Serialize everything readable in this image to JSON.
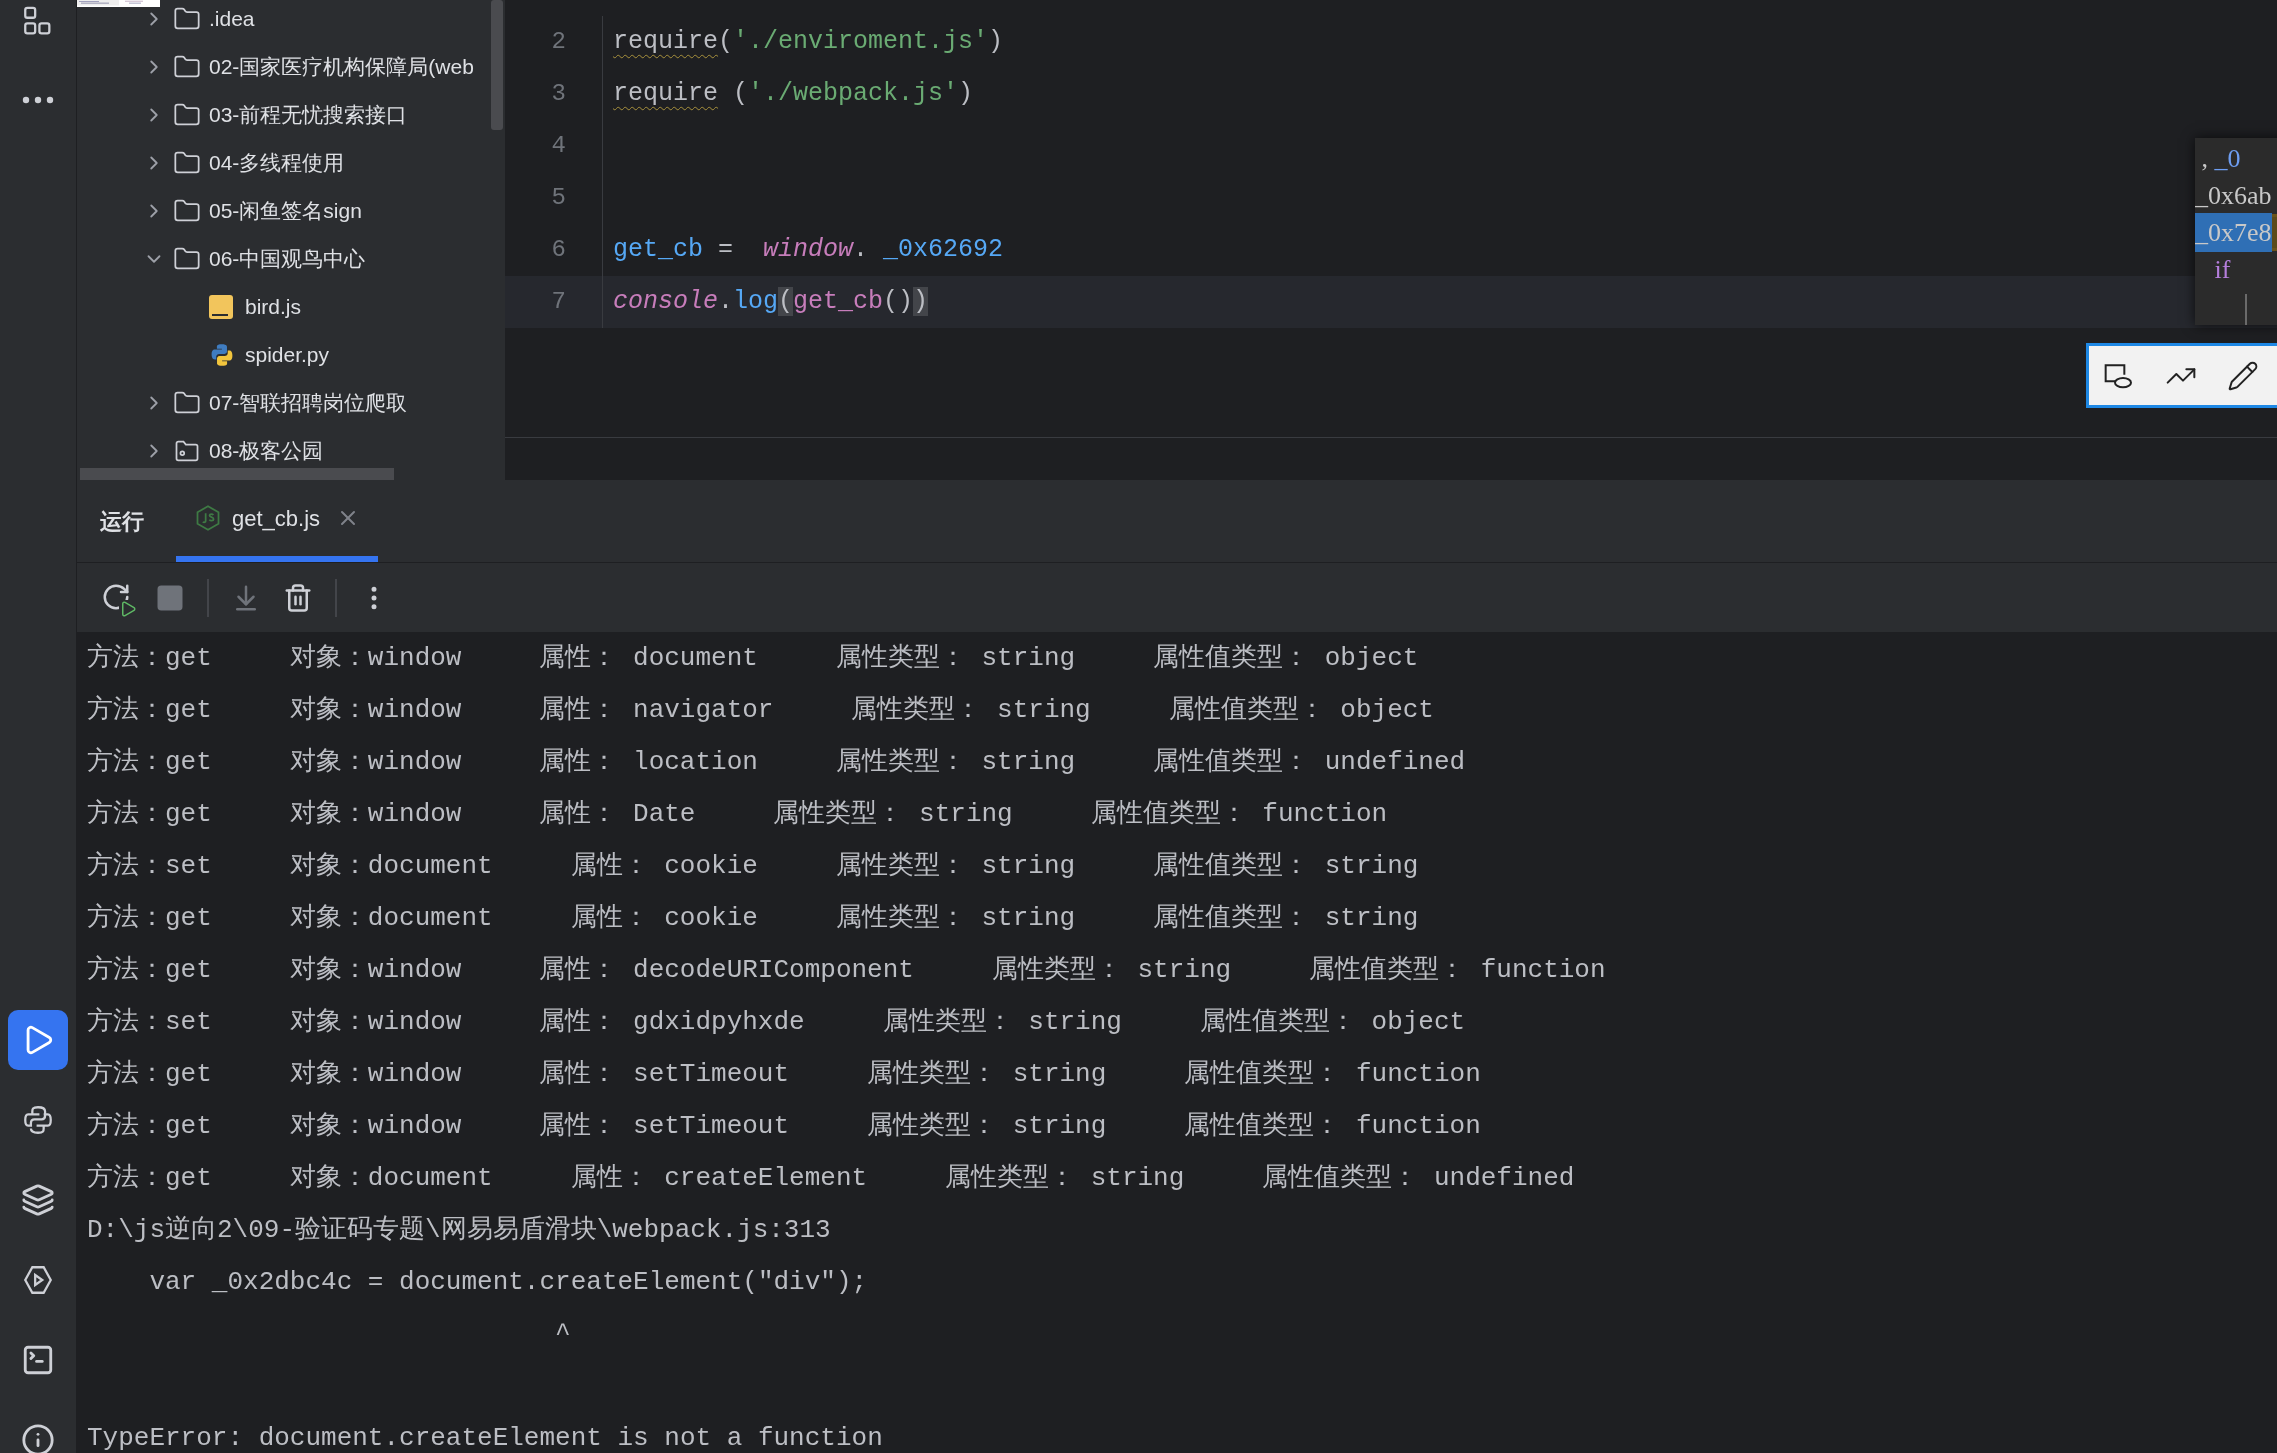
{
  "activity_bar": {
    "top": [
      {
        "kind": "grid",
        "selected": false
      },
      {
        "kind": "more",
        "selected": false
      }
    ],
    "bottom": [
      {
        "kind": "run",
        "selected": true
      },
      {
        "kind": "python",
        "selected": false
      },
      {
        "kind": "layers",
        "selected": false
      },
      {
        "kind": "services",
        "selected": false
      },
      {
        "kind": "terminal",
        "selected": false
      },
      {
        "kind": "problems",
        "selected": false
      }
    ]
  },
  "project_tree": {
    "items": [
      {
        "label": ".idea",
        "kind": "folder",
        "expanded": false
      },
      {
        "label": "02-国家医疗机构保障局(web",
        "kind": "folder",
        "expanded": false
      },
      {
        "label": "03-前程无忧搜索接口",
        "kind": "folder",
        "expanded": false
      },
      {
        "label": "04-多线程使用",
        "kind": "folder",
        "expanded": false
      },
      {
        "label": "05-闲鱼签名sign",
        "kind": "folder",
        "expanded": false
      },
      {
        "label": "06-中国观鸟中心",
        "kind": "folder",
        "expanded": true,
        "children": [
          {
            "label": "bird.js",
            "kind": "js"
          },
          {
            "label": "spider.py",
            "kind": "python"
          }
        ]
      },
      {
        "label": "07-智联招聘岗位爬取",
        "kind": "folder",
        "expanded": false
      },
      {
        "label": "08-极客公园",
        "kind": "module",
        "expanded": false
      }
    ]
  },
  "editor": {
    "lines": [
      {
        "number": "2",
        "current": false,
        "tokens": [
          {
            "text": "require",
            "kind": "warned"
          },
          {
            "text": "(",
            "kind": "plain"
          },
          {
            "text": "'./enviroment.js'",
            "kind": "string"
          },
          {
            "text": ")",
            "kind": "plain"
          }
        ]
      },
      {
        "number": "3",
        "current": false,
        "tokens": [
          {
            "text": "require",
            "kind": "warned"
          },
          {
            "text": " (",
            "kind": "plain"
          },
          {
            "text": "'./webpack.js'",
            "kind": "string"
          },
          {
            "text": ")",
            "kind": "plain"
          }
        ]
      },
      {
        "number": "4",
        "current": false
      },
      {
        "number": "5",
        "current": false
      },
      {
        "number": "6",
        "current": false,
        "tokens": [
          {
            "text": "get_cb",
            "kind": "variable"
          },
          {
            "text": " =  ",
            "kind": "plain"
          },
          {
            "text": "window",
            "kind": "global"
          },
          {
            "text": ". ",
            "kind": "plain"
          },
          {
            "text": "_0x62692",
            "kind": "variable"
          }
        ]
      },
      {
        "number": "7",
        "current": true,
        "tokens": [
          {
            "text": "console",
            "kind": "global"
          },
          {
            "text": ".",
            "kind": "plain"
          },
          {
            "text": "log",
            "kind": "variable"
          },
          {
            "text": "(",
            "kind": "matched"
          },
          {
            "text": "get_cb",
            "kind": "call"
          },
          {
            "text": "()",
            "kind": "plain"
          },
          {
            "text": ")",
            "kind": "matched"
          }
        ]
      }
    ]
  },
  "code_peek": {
    "lines": [
      {
        "selected": false,
        "tokens": [
          {
            "text": " , ",
            "kind": "plain"
          },
          {
            "text": "_0",
            "kind": "variable"
          }
        ]
      },
      {
        "selected": false,
        "tokens": [
          {
            "text": "_0x6ab",
            "kind": "plain"
          }
        ]
      },
      {
        "selected": true,
        "tokens": [
          {
            "text": "_0x7e8",
            "kind": "plain"
          }
        ]
      },
      {
        "selected": false,
        "tokens": [
          {
            "text": "   if",
            "kind": "keyword"
          }
        ]
      }
    ]
  },
  "snip_toolbar": {
    "tools": [
      {
        "kind": "shape"
      },
      {
        "kind": "trend"
      },
      {
        "kind": "pen"
      }
    ]
  },
  "run_panel": {
    "title": "运行",
    "tabs": [
      {
        "label": "get_cb.js",
        "selected": true
      }
    ],
    "toolbar": [
      {
        "kind": "rerun",
        "disabled": false
      },
      {
        "kind": "stop",
        "disabled": true
      },
      {
        "kind": "separator"
      },
      {
        "kind": "scroll",
        "disabled": true
      },
      {
        "kind": "clear",
        "disabled": false
      },
      {
        "kind": "separator"
      },
      {
        "kind": "more",
        "disabled": false
      }
    ],
    "console": [
      {
        "kind": "log",
        "text": "方法：get     对象：window     属性： document     属性类型： string     属性值类型： object"
      },
      {
        "kind": "log",
        "text": "方法：get     对象：window     属性： navigator     属性类型： string     属性值类型： object"
      },
      {
        "kind": "log",
        "text": "方法：get     对象：window     属性： location     属性类型： string     属性值类型： undefined"
      },
      {
        "kind": "log",
        "text": "方法：get     对象：window     属性： Date     属性类型： string     属性值类型： function"
      },
      {
        "kind": "log",
        "text": "方法：set     对象：document     属性： cookie     属性类型： string     属性值类型： string"
      },
      {
        "kind": "log",
        "text": "方法：get     对象：document     属性： cookie     属性类型： string     属性值类型： string"
      },
      {
        "kind": "log",
        "text": "方法：get     对象：window     属性： decodeURIComponent     属性类型： string     属性值类型： function"
      },
      {
        "kind": "log",
        "text": "方法：set     对象：window     属性： gdxidpyhxde     属性类型： string     属性值类型： object"
      },
      {
        "kind": "log",
        "text": "方法：get     对象：window     属性： setTimeout     属性类型： string     属性值类型： function"
      },
      {
        "kind": "log",
        "text": "方法：get     对象：window     属性： setTimeout     属性类型： string     属性值类型： function"
      },
      {
        "kind": "log",
        "text": "方法：get     对象：document     属性： createElement     属性类型： string     属性值类型： undefined"
      },
      {
        "kind": "log",
        "text": "D:\\js逆向2\\09-验证码专题\\网易易盾滑块\\webpack.js:313"
      },
      {
        "kind": "log",
        "text": "    var _0x2dbc4c = document.createElement(\"div\");"
      },
      {
        "kind": "log",
        "text": "                              ^"
      },
      {
        "kind": "error",
        "text": "TypeError: document.createElement is not a function"
      }
    ]
  }
}
